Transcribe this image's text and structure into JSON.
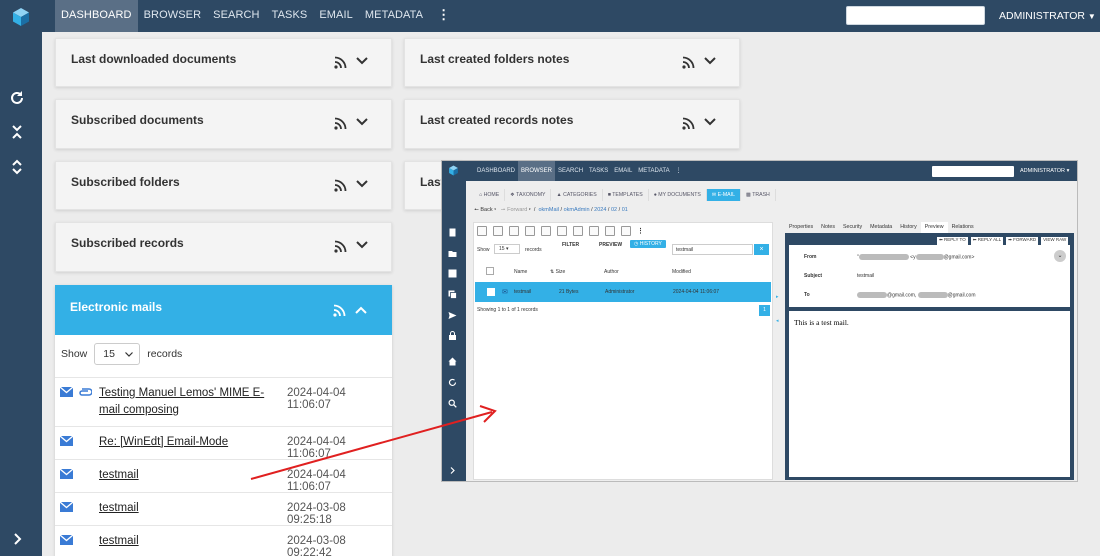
{
  "topbar": {
    "nav": [
      "DASHBOARD",
      "BROWSER",
      "SEARCH",
      "TASKS",
      "EMAIL",
      "METADATA"
    ],
    "user": "ADMINISTRATOR"
  },
  "panels": {
    "last_downloaded": "Last downloaded documents",
    "last_created_folders_notes": "Last created folders notes",
    "subscribed_documents": "Subscribed documents",
    "last_created_records_notes": "Last created records notes",
    "subscribed_folders": "Subscribed folders",
    "last_hidden": "Last",
    "subscribed_records": "Subscribed records"
  },
  "email_panel": {
    "title": "Electronic mails",
    "show_label": "Show",
    "show_value": "15",
    "records_label": "records",
    "rows": [
      {
        "subject": "Testing Manuel Lemos' MIME E-mail composing",
        "date": "2024-04-04 11:06:07",
        "attachment": true
      },
      {
        "subject": "Re: [WinEdt] Email-Mode",
        "date": "2024-04-04 11:06:07",
        "attachment": false
      },
      {
        "subject": "testmail",
        "date": "2024-04-04 11:06:07",
        "attachment": false
      },
      {
        "subject": "testmail",
        "date": "2024-03-08 09:25:18",
        "attachment": false
      },
      {
        "subject": "testmail",
        "date": "2024-03-08 09:22:42",
        "attachment": false
      }
    ]
  },
  "shot": {
    "nav": [
      "DASHBOARD",
      "BROWSER",
      "SEARCH",
      "TASKS",
      "EMAIL",
      "METADATA"
    ],
    "user": "ADMINISTRATOR",
    "tabs": [
      "HOME",
      "TAXONOMY",
      "CATEGORIES",
      "TEMPLATES",
      "MY DOCUMENTS",
      "E-MAIL",
      "TRASH"
    ],
    "back": "Back",
    "forward": "Forward",
    "path": [
      "okmMail",
      "okmAdmin",
      "2024",
      "02",
      "01"
    ],
    "filter": "FILTER",
    "preview": "PREVIEW",
    "history": "HISTORY",
    "search_value": "testmail",
    "show_label": "Show",
    "show_value": "15",
    "records_label": "records",
    "columns": [
      "Name",
      "Size",
      "Author",
      "Modified"
    ],
    "row": {
      "name": "testmail",
      "size": "21 Bytes",
      "author": "Administrator",
      "modified": "2024-04-04 11:06:07"
    },
    "showing": "Showing 1 to 1 of 1 records",
    "right_tabs": [
      "Properties",
      "Notes",
      "Security",
      "Metadata",
      "History",
      "Preview",
      "Relations"
    ],
    "actions": [
      "REPLY TO",
      "REPLY ALL",
      "FORWARD",
      "VIEW RAW"
    ],
    "from_label": "From",
    "subject_label": "Subject",
    "subject_value": "testmail",
    "to_label": "To",
    "from_suffix": "@gmail.com>",
    "to_suffix1": "@gmail.com,",
    "to_suffix2": "@gmail.com",
    "body": "This is a test mail."
  }
}
